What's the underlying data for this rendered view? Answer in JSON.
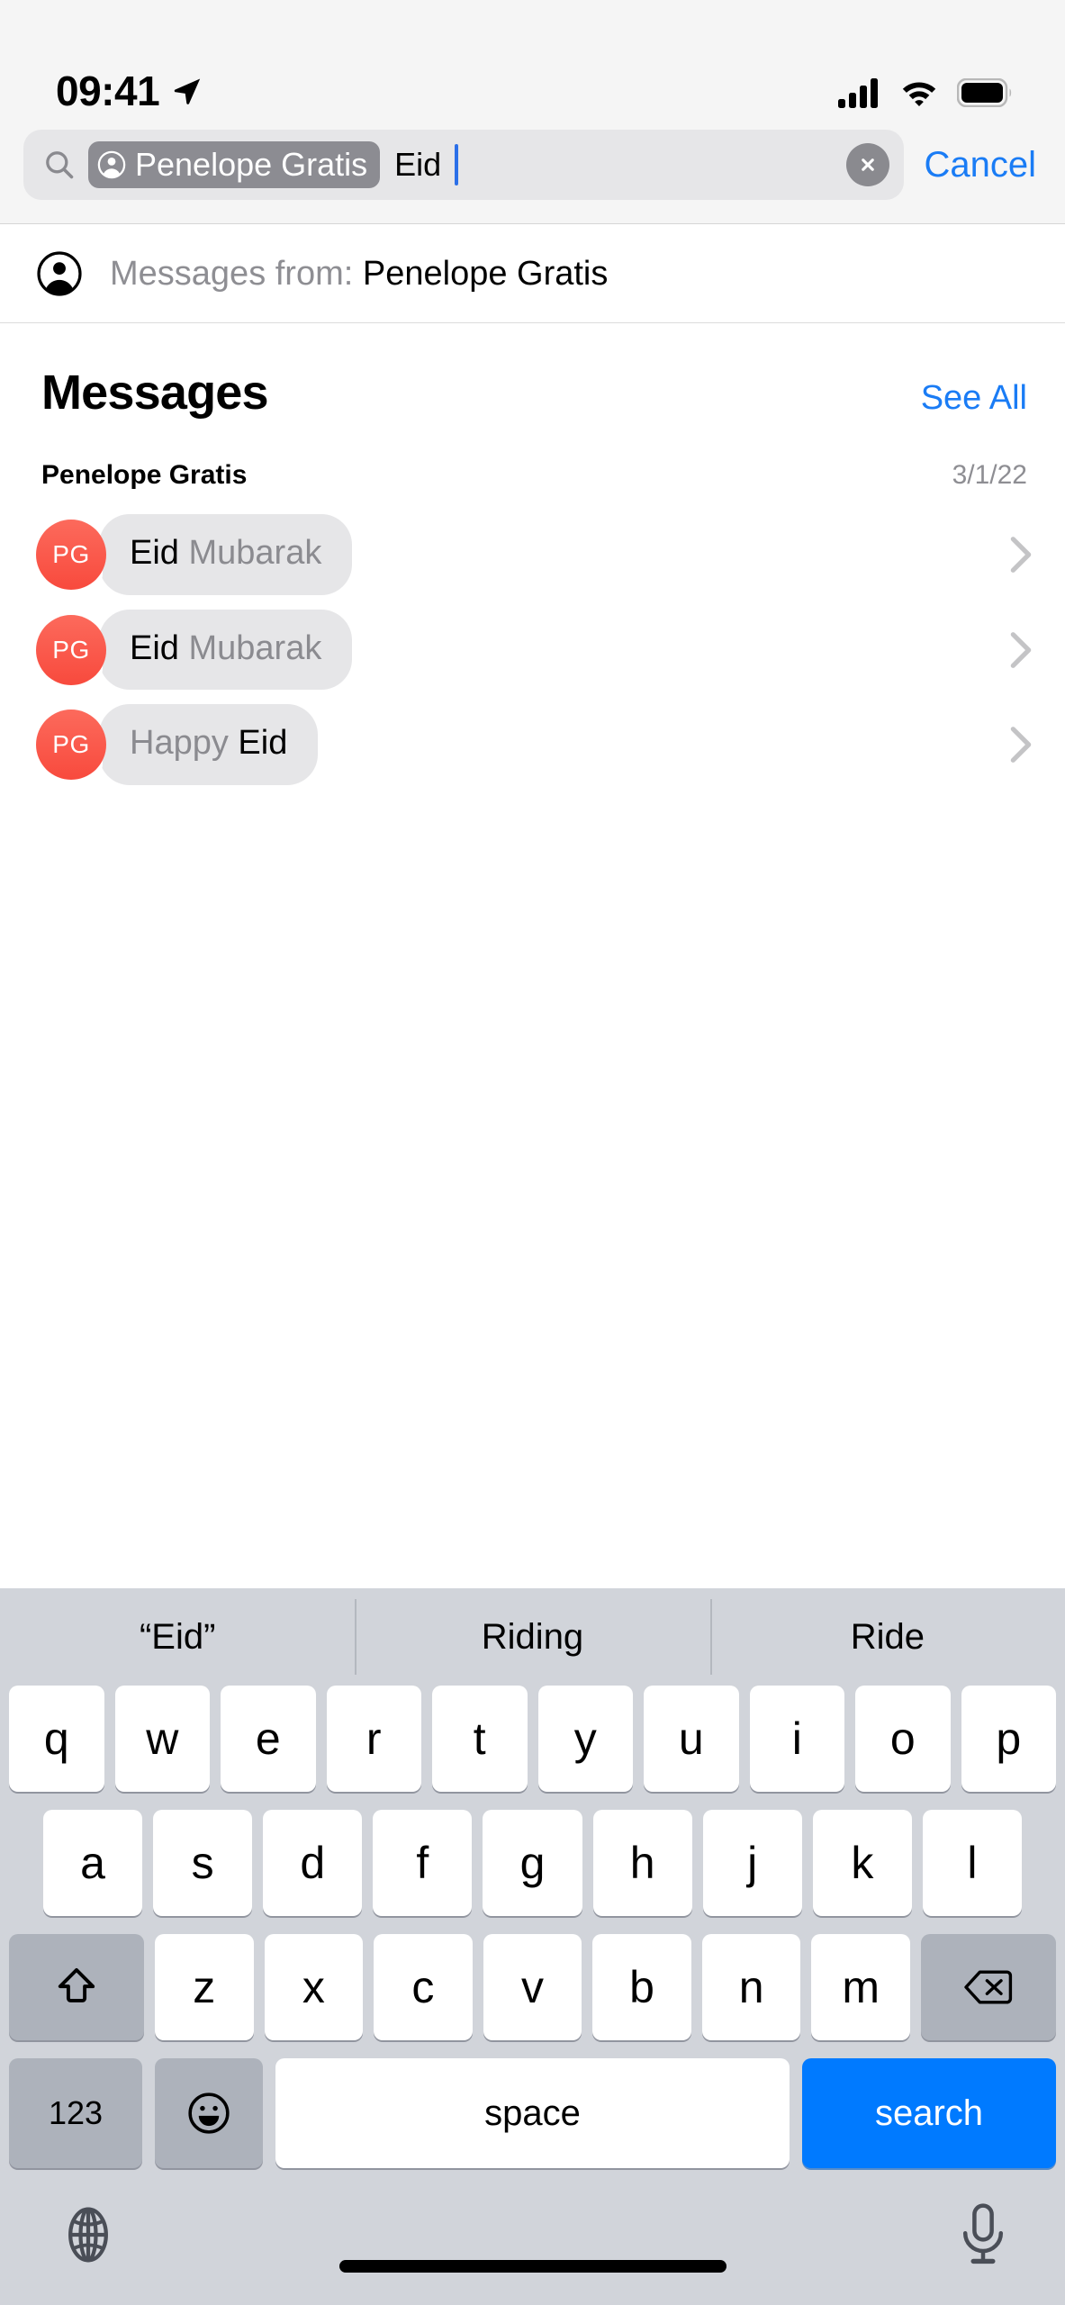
{
  "status_bar": {
    "time": "09:41",
    "location_icon": "location-arrow-icon",
    "cellular_icon": "cellular-bars-icon",
    "wifi_icon": "wifi-icon",
    "battery_icon": "battery-full-icon"
  },
  "search": {
    "icon": "search-icon",
    "token": {
      "icon": "person-circle-icon",
      "label": "Penelope Gratis"
    },
    "query": "Eid",
    "clear_icon": "clear-circle-icon",
    "cancel_label": "Cancel"
  },
  "suggestion": {
    "icon": "person-circle-icon",
    "prefix": "Messages from:",
    "value": "Penelope Gratis"
  },
  "results": {
    "section_title": "Messages",
    "see_all_label": "See All",
    "conversation": {
      "name": "Penelope Gratis",
      "date": "3/1/22"
    },
    "messages": [
      {
        "avatar_initials": "PG",
        "match": "Eid",
        "rest": " Mubarak",
        "match_first": true,
        "chevron": "chevron-right-icon"
      },
      {
        "avatar_initials": "PG",
        "match": "Eid",
        "rest": " Mubarak",
        "match_first": true,
        "chevron": "chevron-right-icon"
      },
      {
        "avatar_initials": "PG",
        "match": "Eid",
        "rest": "Happy ",
        "match_first": false,
        "chevron": "chevron-right-icon"
      }
    ]
  },
  "keyboard": {
    "predictions": [
      "“Eid”",
      "Riding",
      "Ride"
    ],
    "row1": [
      "q",
      "w",
      "e",
      "r",
      "t",
      "y",
      "u",
      "i",
      "o",
      "p"
    ],
    "row2": [
      "a",
      "s",
      "d",
      "f",
      "g",
      "h",
      "j",
      "k",
      "l"
    ],
    "row3": [
      "z",
      "x",
      "c",
      "v",
      "b",
      "n",
      "m"
    ],
    "shift_icon": "shift-arrow-icon",
    "backspace_icon": "delete-backspace-icon",
    "numbers_label": "123",
    "emoji_icon": "emoji-smiley-icon",
    "space_label": "space",
    "search_label": "search",
    "globe_icon": "globe-icon",
    "microphone_icon": "microphone-icon"
  },
  "colors": {
    "accent_blue": "#007aff",
    "link_blue": "#1a7cf5",
    "avatar_red": "#f84a3d",
    "bubble_gray": "#e6e6e8",
    "keyboard_bg": "#d1d4da",
    "token_gray": "#8c8c92"
  }
}
